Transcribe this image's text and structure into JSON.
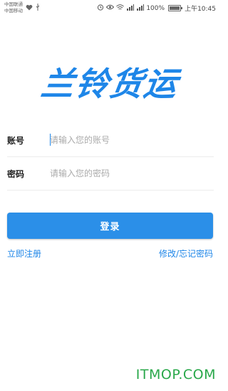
{
  "status_bar": {
    "carrier_1": "中国联通",
    "carrier_2": "中国移动",
    "battery": "100%",
    "time": "上午10:45"
  },
  "app": {
    "logo_text": "兰铃货运"
  },
  "form": {
    "account_label": "账号",
    "account_placeholder": "请输入您的账号",
    "account_value": "",
    "password_label": "密码",
    "password_placeholder": "请输入您的密码",
    "password_value": ""
  },
  "actions": {
    "login_label": "登录",
    "register_label": "立即注册",
    "forgot_label": "修改/忘记密码"
  },
  "watermark": "ITMOP.COM",
  "colors": {
    "accent": "#1e86e8",
    "button": "#2b8fe8",
    "watermark": "#29a84a"
  }
}
